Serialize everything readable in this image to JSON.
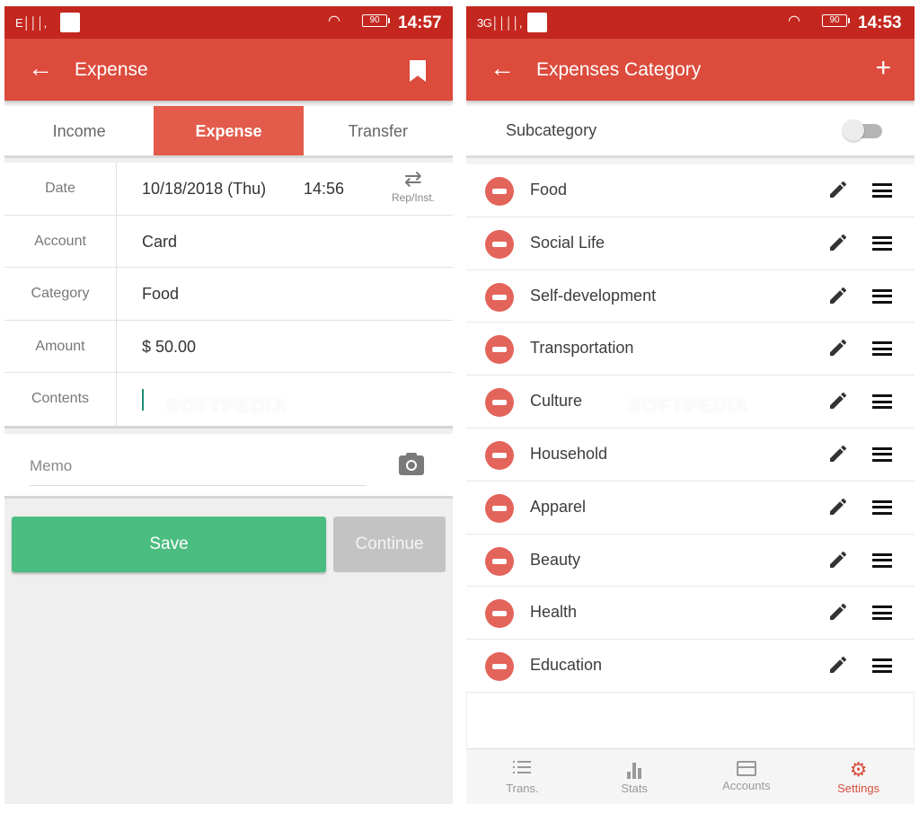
{
  "left_screen": {
    "status_bar": {
      "signal": "E │││,",
      "battery": "90",
      "time": "14:57"
    },
    "app_bar": {
      "title": "Expense",
      "back_icon": "arrow-left-icon",
      "action_icon": "bookmark-icon"
    },
    "tabs": [
      {
        "label": "Income",
        "active": false
      },
      {
        "label": "Expense",
        "active": true
      },
      {
        "label": "Transfer",
        "active": false
      }
    ],
    "form": {
      "date": {
        "label": "Date",
        "value": "10/18/2018 (Thu)",
        "time": "14:56",
        "repeat_label": "Rep/Inst."
      },
      "account": {
        "label": "Account",
        "value": "Card"
      },
      "category": {
        "label": "Category",
        "value": "Food"
      },
      "amount": {
        "label": "Amount",
        "value": "$ 50.00"
      },
      "contents": {
        "label": "Contents",
        "value": ""
      }
    },
    "memo": {
      "placeholder": "Memo"
    },
    "buttons": {
      "save": "Save",
      "continue": "Continue"
    },
    "colors": {
      "accent": "#dc4b3c",
      "status": "#c4271f",
      "save": "#4bbd80",
      "continue": "#c3c3c3"
    }
  },
  "right_screen": {
    "status_bar": {
      "signal": "3G││││,",
      "battery": "90",
      "time": "14:53"
    },
    "app_bar": {
      "title": "Expenses Category",
      "back_icon": "arrow-left-icon",
      "action_icon": "plus-icon"
    },
    "subcategory": {
      "label": "Subcategory",
      "enabled": false
    },
    "categories": [
      {
        "name": "Food"
      },
      {
        "name": "Social Life"
      },
      {
        "name": "Self-development"
      },
      {
        "name": "Transportation"
      },
      {
        "name": "Culture"
      },
      {
        "name": "Household"
      },
      {
        "name": "Apparel"
      },
      {
        "name": "Beauty"
      },
      {
        "name": "Health"
      },
      {
        "name": "Education"
      }
    ],
    "bottom_nav": [
      {
        "label": "Trans.",
        "icon": "list-icon",
        "active": false
      },
      {
        "label": "Stats",
        "icon": "bar-chart-icon",
        "active": false
      },
      {
        "label": "Accounts",
        "icon": "card-icon",
        "active": false
      },
      {
        "label": "Settings",
        "icon": "gear-icon",
        "active": true
      }
    ],
    "colors": {
      "delete": "#e3645a",
      "active_nav": "#d5503f"
    }
  },
  "watermark": "SOFTPEDIA"
}
